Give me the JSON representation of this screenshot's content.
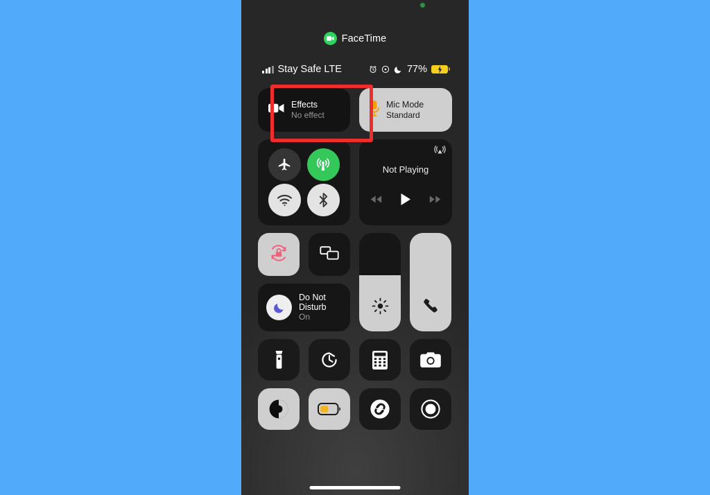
{
  "screen": {
    "app_pill": {
      "label": "FaceTime",
      "icon": "video-camera-icon",
      "badge_color": "#2fd45f"
    },
    "privacy_indicator": {
      "name": "green-camera-privacy-dot",
      "color": "#2f8f48"
    },
    "status_bar": {
      "carrier": "Stay Safe LTE",
      "signal_bars_filled": 3,
      "signal_bars_total": 4,
      "icons": [
        "alarm-clock-icon",
        "orientation-lock-icon",
        "moon-icon"
      ],
      "battery_percent": "77%",
      "battery_charging": true,
      "battery_color": "#f7cf1c"
    },
    "highlight": {
      "name": "effects-highlight-box",
      "color": "#ee2d2d"
    }
  },
  "control_center": {
    "effects_tile": {
      "title": "Effects",
      "subtitle": "No effect",
      "icon": "video-camera-icon",
      "active": false
    },
    "mic_mode_tile": {
      "title": "Mic Mode",
      "subtitle": "Standard",
      "icon": "microphone-icon",
      "icon_color": "#f59f0b",
      "active": true
    },
    "connectivity": {
      "airplane_mode": {
        "label": "Airplane Mode",
        "icon": "airplane-icon",
        "on": false
      },
      "cellular_data": {
        "label": "Cellular Data",
        "icon": "cellular-antenna-icon",
        "on": true,
        "color": "#34c759"
      },
      "wifi": {
        "label": "Wi-Fi",
        "icon": "wifi-icon",
        "on": true
      },
      "bluetooth": {
        "label": "Bluetooth",
        "icon": "bluetooth-icon",
        "on": true
      }
    },
    "now_playing": {
      "title": "Not Playing",
      "airplay_icon": "airplay-audio-icon",
      "controls": [
        "rewind-icon",
        "play-icon",
        "fast-forward-icon"
      ]
    },
    "rotation_lock": {
      "label": "Portrait Orientation Lock",
      "icon": "rotation-lock-icon",
      "on": true,
      "icon_color": "#f0617a"
    },
    "screen_mirroring": {
      "label": "Screen Mirroring",
      "icon": "screen-mirroring-icon",
      "on": false
    },
    "do_not_disturb": {
      "line1": "Do Not",
      "line2": "Disturb",
      "status": "On",
      "icon": "crescent-moon-icon",
      "icon_color": "#5b58d8",
      "on": true
    },
    "brightness_slider": {
      "label": "Brightness",
      "icon": "sun-icon",
      "value_percent": 57
    },
    "volume_slider": {
      "label": "Ringer Volume",
      "icon": "phone-handset-icon",
      "value_percent": 100
    },
    "shortcuts_row_1": [
      {
        "label": "Flashlight",
        "icon": "flashlight-icon",
        "on": false
      },
      {
        "label": "Timer",
        "icon": "timer-icon",
        "on": false
      },
      {
        "label": "Calculator",
        "icon": "calculator-icon",
        "on": false
      },
      {
        "label": "Camera",
        "icon": "camera-icon",
        "on": false
      }
    ],
    "shortcuts_row_2": [
      {
        "label": "Dark Mode",
        "icon": "dark-mode-icon",
        "on": true
      },
      {
        "label": "Low Power Mode",
        "icon": "battery-icon",
        "on": true,
        "icon_color": "#f5b41c"
      },
      {
        "label": "Shazam",
        "icon": "shazam-icon",
        "on": false
      },
      {
        "label": "Screen Recording",
        "icon": "screen-record-icon",
        "on": false
      }
    ]
  },
  "home_indicator": {
    "name": "home-indicator"
  }
}
